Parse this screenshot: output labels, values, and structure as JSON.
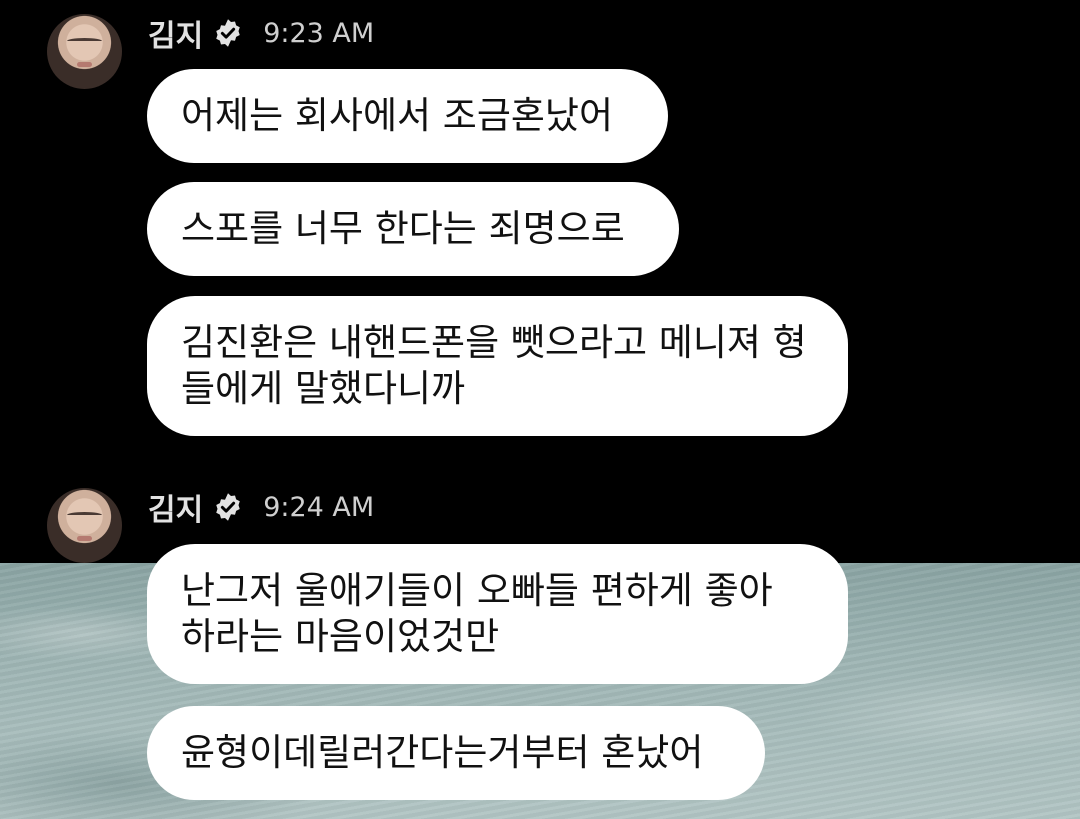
{
  "groups": [
    {
      "sender": "김지",
      "time": "9:23 AM",
      "messages": [
        "어제는 회사에서 조금혼났어",
        "스포를 너무 한다는 죄명으로",
        "김진환은 내핸드폰을 뺏으라고 메니져 형들에게 말했다니까"
      ]
    },
    {
      "sender": "김지",
      "time": "9:24 AM",
      "messages": [
        "난그저 울애기들이 오빠들 편하게 좋아 하라는 마음이었것만",
        "윤형이데릴러간다는거부터 혼났어"
      ]
    }
  ],
  "icons": {
    "verified": "verified-badge-icon",
    "avatar": "profile-avatar"
  },
  "colors": {
    "background": "#000000",
    "bubble": "#ffffff",
    "name": "#e2e2e2"
  }
}
